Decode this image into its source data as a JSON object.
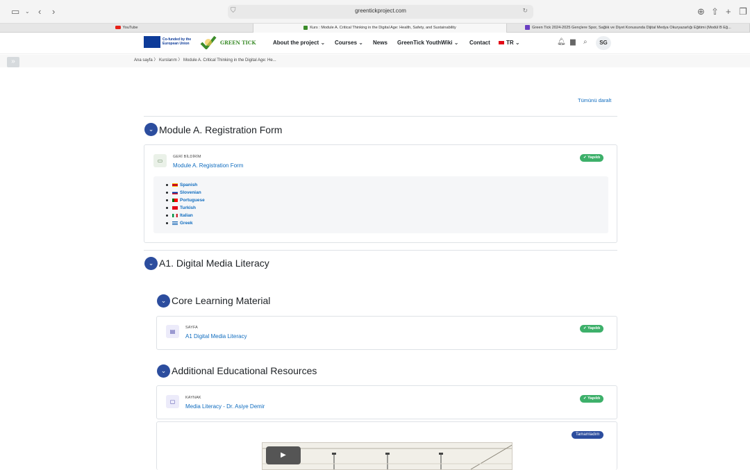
{
  "browser": {
    "url": "greentickproject.com",
    "tabs": [
      {
        "label": "YouTube"
      },
      {
        "label": "Kurs : Module A. Critical Thinking in the Digital Age: Health, Safety, and Sustainability"
      },
      {
        "label": "Green Tick 2024-2025 Gençlere Spor, Sağlık ve Diyet Konusunda Dijital Medya Okuryazarlığı Eğitimi (Modül B Eğ..."
      }
    ]
  },
  "site": {
    "eu_label": "Co-funded by the European Union",
    "logo_text": "GREEN TICK",
    "nav": {
      "about": "About the project",
      "courses": "Courses",
      "news": "News",
      "wiki": "GreenTick YouthWiki",
      "contact": "Contact",
      "lang": "TR"
    },
    "avatar": "SG"
  },
  "breadcrumb": {
    "home": "Ana sayfa",
    "courses": "Kurslarım",
    "current": "Module A. Critical Thinking in the Digital Age: He..."
  },
  "content": {
    "collapse_all": "Tümünü daralt",
    "sections": {
      "s1": {
        "title": "Module A. Registration Form",
        "activity": {
          "type": "GERİ BİLDİRİM",
          "name": "Module A. Registration Form",
          "status": "✔ Yapıldı"
        },
        "languages": [
          "Spanish",
          "Slovenian",
          "Portuguese",
          "Turkish",
          "Italian",
          "Greek"
        ]
      },
      "s2": {
        "title": "A1. Digital Media Literacy"
      },
      "s3": {
        "title": "Core Learning Material",
        "activity": {
          "type": "SAYFA",
          "name": "A1 Digital Media Literacy",
          "status": "✔ Yapıldı"
        }
      },
      "s4": {
        "title": "Additional Educational Resources",
        "activity": {
          "type": "KAYNAK",
          "name": "Media Literacy - Dr. Asiye Demir",
          "status": "✔ Yapıldı"
        },
        "mark_done": "Tamamladım"
      }
    }
  }
}
